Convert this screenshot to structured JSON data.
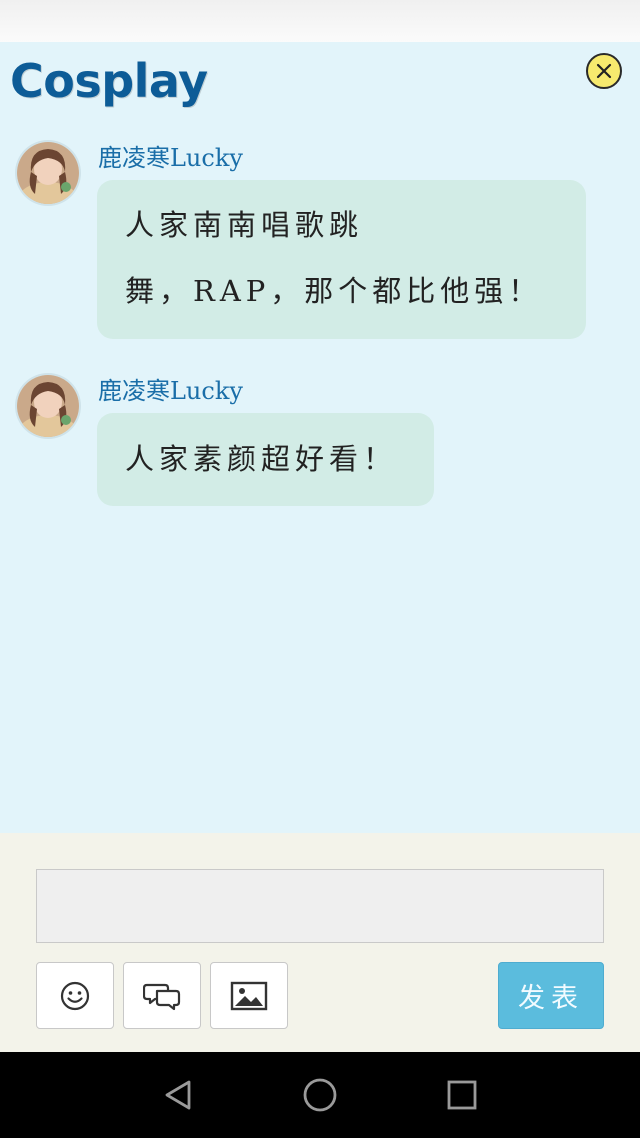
{
  "header": {
    "title": "Cosplay",
    "close_icon": "close-circle-icon"
  },
  "messages": [
    {
      "sender": "鹿凌寒Lucky",
      "lines": [
        "人家南南唱歌跳",
        "舞，RAP，那个都比他强！"
      ]
    },
    {
      "sender": "鹿凌寒Lucky",
      "lines": [
        "人家素颜超好看！"
      ]
    }
  ],
  "composer": {
    "input_value": "",
    "send_label": "发表",
    "tools": [
      "emoji-icon",
      "chat-bubbles-icon",
      "image-icon"
    ]
  },
  "navigation": {
    "buttons": [
      "back-icon",
      "home-icon",
      "recents-icon"
    ]
  },
  "colors": {
    "chat_background": "#e2f4fa",
    "title": "#0d5c97",
    "bubble": "#d2ece6",
    "send_button": "#5bbcdd",
    "close_button": "#f7ea6e"
  }
}
